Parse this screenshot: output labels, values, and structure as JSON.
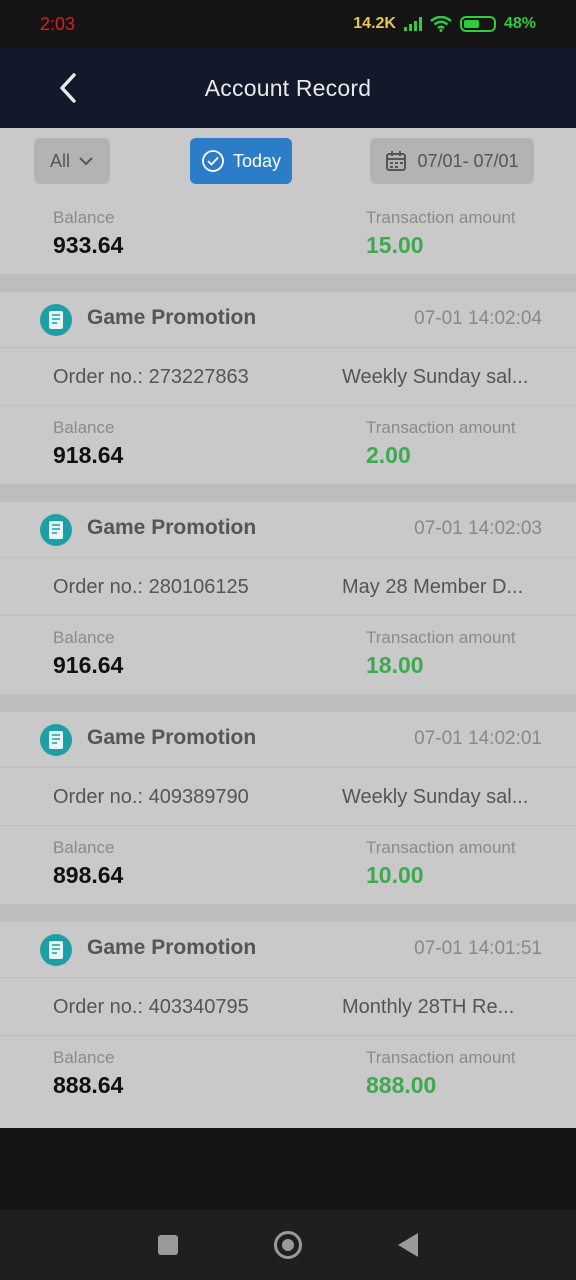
{
  "status_bar": {
    "time": "2:03",
    "network_speed": "14.2K",
    "battery": "48%"
  },
  "header": {
    "title": "Account Record"
  },
  "filters": {
    "all_label": "All",
    "today_label": "Today",
    "date_range": "07/01- 07/01"
  },
  "labels": {
    "balance": "Balance",
    "transaction_amount": "Transaction amount",
    "order_prefix": "Order no.: "
  },
  "summary": {
    "balance": "933.64",
    "amount": "15.00"
  },
  "records": [
    {
      "title": "Game Promotion",
      "time": "07-01 14:02:04",
      "order_no": "Order no.: 273227863",
      "description": "Weekly Sunday sal...",
      "balance": "918.64",
      "amount": "2.00"
    },
    {
      "title": "Game Promotion",
      "time": "07-01 14:02:03",
      "order_no": "Order no.: 280106125",
      "description": "May 28 Member D...",
      "balance": "916.64",
      "amount": "18.00"
    },
    {
      "title": "Game Promotion",
      "time": "07-01 14:02:01",
      "order_no": "Order no.: 409389790",
      "description": "Weekly Sunday sal...",
      "balance": "898.64",
      "amount": "10.00"
    },
    {
      "title": "Game Promotion",
      "time": "07-01 14:01:51",
      "order_no": "Order no.: 403340795",
      "description": "Monthly 28TH Re...",
      "balance": "888.64",
      "amount": "888.00"
    }
  ],
  "colors": {
    "accent": "#2a7dc6",
    "amount_green": "#3daa4f",
    "header_bg": "#12192b",
    "icon_teal": "#1e9fa6"
  }
}
